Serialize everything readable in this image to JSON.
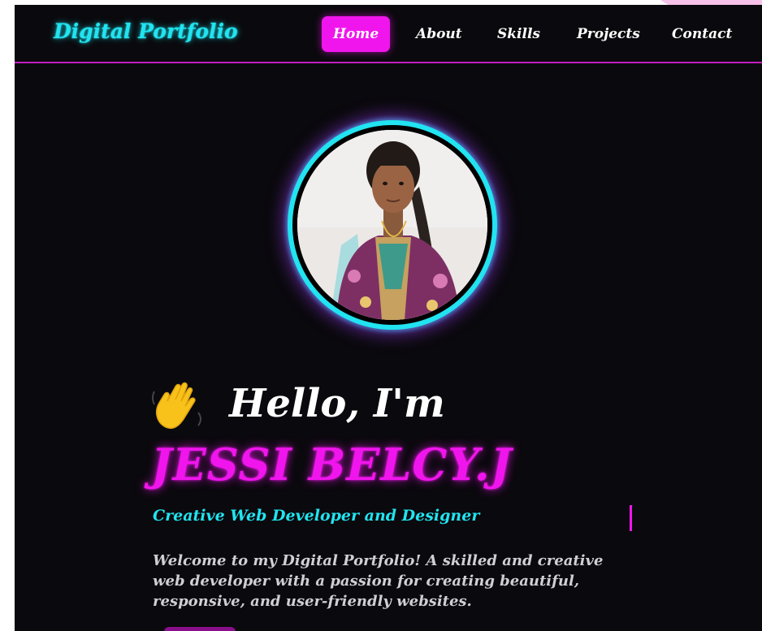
{
  "brand": "Digital Portfolio",
  "nav": {
    "items": [
      {
        "label": "Home",
        "active": true
      },
      {
        "label": "About",
        "active": false
      },
      {
        "label": "Skills",
        "active": false
      },
      {
        "label": "Projects",
        "active": false
      },
      {
        "label": "Contact",
        "active": false
      }
    ]
  },
  "hero": {
    "greeting": "Hello, I'm",
    "name": "JESSI BELCY.J",
    "role": "Creative Web Developer and Designer",
    "intro": "Welcome to my Digital Portfolio! A skilled and creative web developer with a passion for creating beautiful, responsive, and user-friendly websites."
  },
  "icons": {
    "wave": "waving-hand-icon",
    "avatar": "profile-photo"
  },
  "colors": {
    "background": "#0a090d",
    "accent_cyan": "#21e4f0",
    "accent_magenta": "#f015ed",
    "nav_border": "#c21fbf",
    "text_light": "#cfcfd4"
  }
}
